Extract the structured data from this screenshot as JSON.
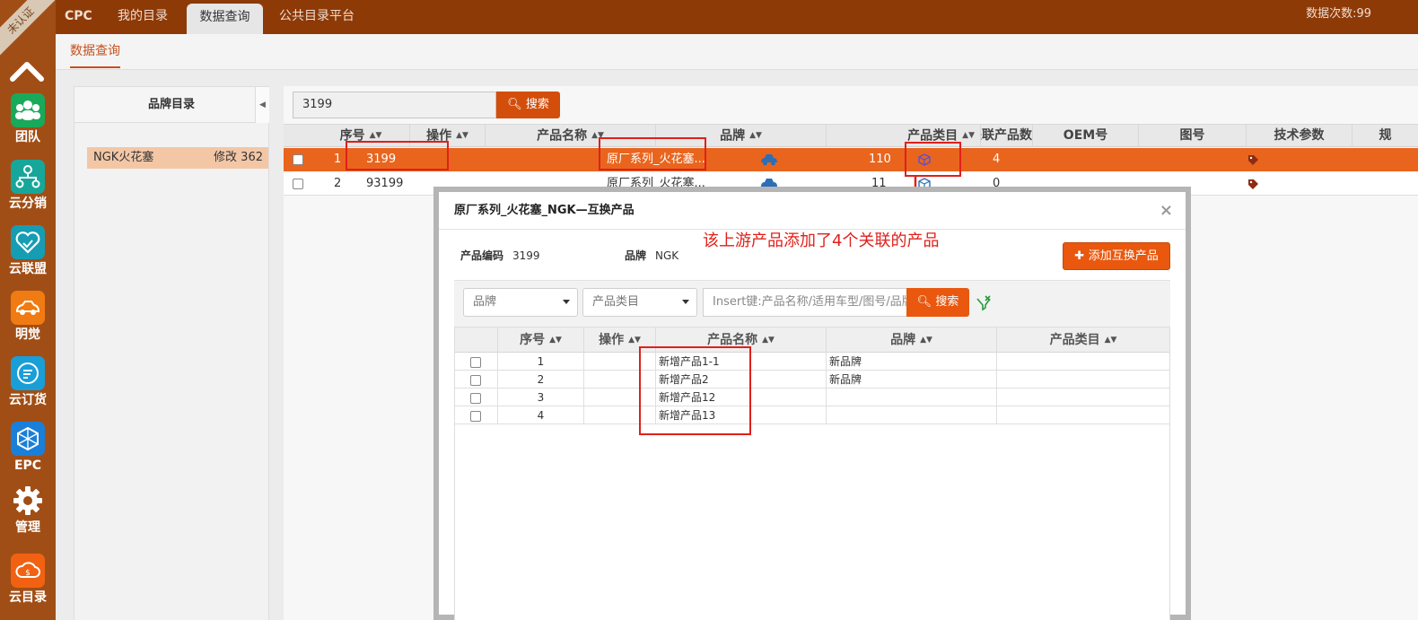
{
  "sidebar": {
    "badge": "未认证",
    "items": [
      {
        "label": "团队",
        "icon": "team-icon",
        "color": "#19a95a"
      },
      {
        "label": "云分销",
        "icon": "distribution-icon",
        "color": "#16a79a"
      },
      {
        "label": "云联盟",
        "icon": "alliance-icon",
        "color": "#169db3"
      },
      {
        "label": "明觉",
        "icon": "car-icon",
        "color": "#f07b12"
      },
      {
        "label": "云订货",
        "icon": "order-icon",
        "color": "#1a9ed8"
      },
      {
        "label": "EPC",
        "icon": "epc-icon",
        "color": "#1a7fd8"
      },
      {
        "label": "管理",
        "icon": "gear-icon",
        "color": "#a14e16"
      },
      {
        "label": "云目录",
        "icon": "catalog-icon",
        "color": "#f06212"
      }
    ]
  },
  "topnav": {
    "items": [
      "CPC",
      "我的目录",
      "数据查询",
      "公共目录平台"
    ],
    "counter": "数据次数:99"
  },
  "subnav": {
    "tab": "数据查询"
  },
  "brand_panel": {
    "title": "品牌目录",
    "item_name": "NGK火花塞",
    "item_action": "修改 362"
  },
  "search": {
    "value": "3199",
    "button": "搜索"
  },
  "grid": {
    "headers": [
      "序号",
      "操作",
      "产品名称",
      "品牌",
      "产品类目",
      "关联产品数",
      "OEM号",
      "图号",
      "技术参数",
      "规"
    ],
    "rows": [
      {
        "no": "1",
        "code": "3199",
        "name": "原厂系列_火花塞...",
        "cat_count": "110",
        "rel": "4"
      },
      {
        "no": "2",
        "code": "93199",
        "name": "原厂系列_火花塞...",
        "cat_count": "11",
        "rel": "0"
      }
    ]
  },
  "modal": {
    "title": "原厂系列_火花塞_NGK—互换产品",
    "close": "×",
    "code_label": "产品编码",
    "code_value": "3199",
    "brand_label": "品牌",
    "brand_value": "NGK",
    "add_button": "添加互换产品",
    "filter_brand": "品牌",
    "filter_category": "产品类目",
    "search_placeholder": "Insert键:产品名称/适用车型/图号/品牌",
    "search_button": "搜索",
    "headers": [
      "序号",
      "操作",
      "产品名称",
      "品牌",
      "产品类目"
    ],
    "rows": [
      {
        "no": "1",
        "name": "新增产品1-1",
        "brand": "新品牌"
      },
      {
        "no": "2",
        "name": "新增产品2",
        "brand": "新品牌"
      },
      {
        "no": "3",
        "name": "新增产品12",
        "brand": ""
      },
      {
        "no": "4",
        "name": "新增产品13",
        "brand": ""
      }
    ]
  },
  "annotation": "该上游产品添加了4个关联的产品",
  "colors": {
    "accent": "#e9580e",
    "topbar": "#8d3a07",
    "sidebar": "#a14e16",
    "highlight": "#e0201a"
  }
}
